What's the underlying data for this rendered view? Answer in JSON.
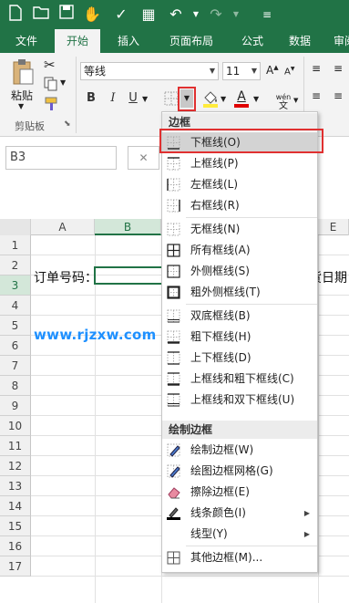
{
  "tabs": [
    {
      "label": "文件"
    },
    {
      "label": "开始"
    },
    {
      "label": "插入"
    },
    {
      "label": "页面布局"
    },
    {
      "label": "公式"
    },
    {
      "label": "数据"
    },
    {
      "label": "审阅"
    }
  ],
  "ribbon": {
    "paste_label": "粘贴",
    "clipboard_group": "剪贴板",
    "font_name": "等线",
    "font_size": "11",
    "bold": "B",
    "italic": "I",
    "underline": "U",
    "font_color_letter": "A",
    "phonetic": "wén"
  },
  "formula_bar": {
    "name_box": "B3",
    "cancel_glyph": "✕"
  },
  "sheet": {
    "columns": [
      "A",
      "B",
      "E"
    ],
    "rows": [
      "1",
      "2",
      "3",
      "4",
      "5",
      "6",
      "7",
      "8",
      "9",
      "10",
      "11",
      "12",
      "13",
      "14",
      "15",
      "16",
      "17"
    ],
    "a3_text": "订单号码：",
    "e3_text": "货日期"
  },
  "watermark": "www.rjzxw.com",
  "menu": {
    "section_border": "边框",
    "section_draw": "绘制边框",
    "items": [
      {
        "label": "下框线(O)",
        "icon": "bottom-border-icon"
      },
      {
        "label": "上框线(P)",
        "icon": "top-border-icon"
      },
      {
        "label": "左框线(L)",
        "icon": "left-border-icon"
      },
      {
        "label": "右框线(R)",
        "icon": "right-border-icon"
      },
      {
        "label": "无框线(N)",
        "icon": "no-border-icon"
      },
      {
        "label": "所有框线(A)",
        "icon": "all-borders-icon"
      },
      {
        "label": "外侧框线(S)",
        "icon": "outside-borders-icon"
      },
      {
        "label": "粗外侧框线(T)",
        "icon": "thick-outside-borders-icon"
      },
      {
        "label": "双底框线(B)",
        "icon": "double-bottom-border-icon"
      },
      {
        "label": "粗下框线(H)",
        "icon": "thick-bottom-border-icon"
      },
      {
        "label": "上下框线(D)",
        "icon": "top-bottom-border-icon"
      },
      {
        "label": "上框线和粗下框线(C)",
        "icon": "top-thick-bottom-border-icon"
      },
      {
        "label": "上框线和双下框线(U)",
        "icon": "top-double-bottom-border-icon"
      },
      {
        "label": "绘制边框(W)",
        "icon": "draw-border-icon"
      },
      {
        "label": "绘图边框网格(G)",
        "icon": "draw-border-grid-icon"
      },
      {
        "label": "擦除边框(E)",
        "icon": "erase-border-icon"
      },
      {
        "label": "线条颜色(I)",
        "icon": "line-color-icon"
      },
      {
        "label": "线型(Y)",
        "icon": "line-style-icon"
      },
      {
        "label": "其他边框(M)...",
        "icon": "more-borders-icon"
      }
    ]
  },
  "colors": {
    "excel_green": "#217346",
    "highlight_red": "#e03030",
    "watermark_blue": "#1e90ff"
  }
}
